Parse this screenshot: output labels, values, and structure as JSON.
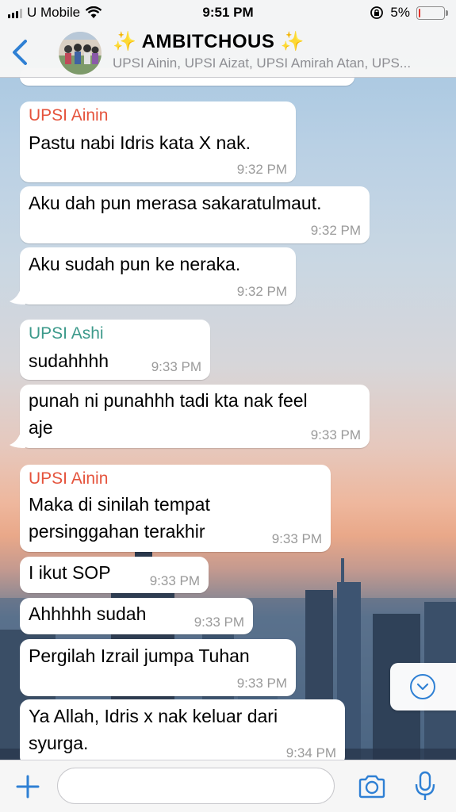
{
  "status": {
    "carrier": "U Mobile",
    "time": "9:51 PM",
    "battery": "5%",
    "battery_level": 0.05
  },
  "header": {
    "title": "AMBITCHOUS",
    "sparkle": "✨",
    "members": "UPSI Ainin, UPSI Aizat, UPSI Amirah Atan, UPS..."
  },
  "colors": {
    "ios_blue": "#2f80d4",
    "sender_ainin": "#e5533c",
    "sender_ashi": "#3d9a8b"
  },
  "messages": [
    {
      "sender": "UPSI Ainin",
      "lines": [
        "Pastu nabi Idris kata X nak."
      ],
      "time": "9:32 PM"
    },
    {
      "lines": [
        "Aku dah pun merasa sakaratulmaut."
      ],
      "time": "9:32 PM"
    },
    {
      "lines": [
        "Aku sudah pun ke neraka."
      ],
      "time": "9:32 PM"
    },
    {
      "sender": "UPSI Ashi",
      "lines": [
        "sudahhhh"
      ],
      "time": "9:33 PM"
    },
    {
      "lines": [
        "punah ni punahhh tadi kta nak feel",
        "aje"
      ],
      "time": "9:33 PM"
    },
    {
      "sender": "UPSI Ainin",
      "lines": [
        "Maka di sinilah tempat",
        "persinggahan terakhir"
      ],
      "time": "9:33 PM"
    },
    {
      "lines": [
        "I ikut SOP"
      ],
      "time": "9:33 PM"
    },
    {
      "lines": [
        "Ahhhhh sudah"
      ],
      "time": "9:33 PM"
    },
    {
      "lines": [
        "Pergilah Izrail jumpa Tuhan"
      ],
      "time": "9:33 PM"
    },
    {
      "lines": [
        "Ya Allah, Idris x nak keluar dari",
        "syurga."
      ],
      "time": "9:34 PM"
    }
  ],
  "input": {
    "placeholder": ""
  }
}
